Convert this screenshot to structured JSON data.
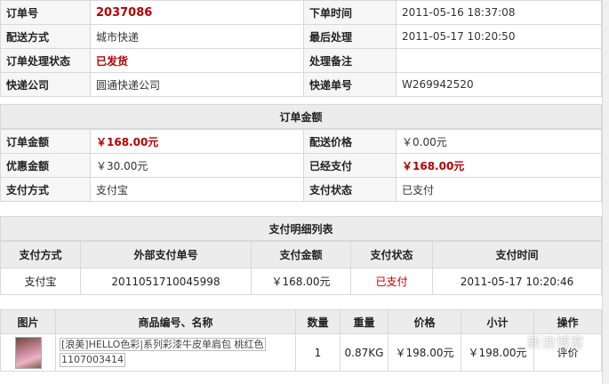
{
  "order": {
    "rows": [
      [
        {
          "label": "订单号",
          "value": "2037086"
        },
        {
          "label": "下单时间",
          "value": "2011-05-16 18:37:08"
        }
      ],
      [
        {
          "label": "配送方式",
          "value": "城市快递"
        },
        {
          "label": "最后处理",
          "value": "2011-05-17 10:20:50"
        }
      ],
      [
        {
          "label": "订单处理状态",
          "value": "已发货"
        },
        {
          "label": "处理备注",
          "value": ""
        }
      ],
      [
        {
          "label": "快递公司",
          "value": "圆通快递公司"
        },
        {
          "label": "快递单号",
          "value": "W269942520"
        }
      ]
    ]
  },
  "amount": {
    "title": "订单金额",
    "rows": [
      [
        {
          "label": "订单金额",
          "value": "￥168.00元"
        },
        {
          "label": "配送价格",
          "value": "￥0.00元"
        }
      ],
      [
        {
          "label": "优惠金额",
          "value": "￥30.00元"
        },
        {
          "label": "已经支付",
          "value": "￥168.00元"
        }
      ],
      [
        {
          "label": "支付方式",
          "value": "支付宝"
        },
        {
          "label": "支付状态",
          "value": "已支付"
        }
      ]
    ]
  },
  "payment": {
    "title": "支付明细列表",
    "headers": [
      "支付方式",
      "外部支付单号",
      "支付金额",
      "支付状态",
      "支付时间"
    ],
    "row": [
      "支付宝",
      "2011051710045998",
      "￥168.00元",
      "已支付",
      "2011-05-17 10:20:46"
    ]
  },
  "goods": {
    "headers": [
      "图片",
      "商品编号、名称",
      "数量",
      "重量",
      "价格",
      "小计",
      "操作"
    ],
    "row": {
      "name": "[浪美]HELLO色彩|系列彩漆牛皮单肩包 桃红色",
      "code": "1107003414",
      "qty": "1",
      "weight": "0.87KG",
      "price": "￥198.00元",
      "subtotal": "￥198.00元",
      "action": "评价"
    }
  },
  "colors": {
    "accent_red": "#b30000",
    "header_bg": "#ececec"
  },
  "watermark": "新浪博客"
}
